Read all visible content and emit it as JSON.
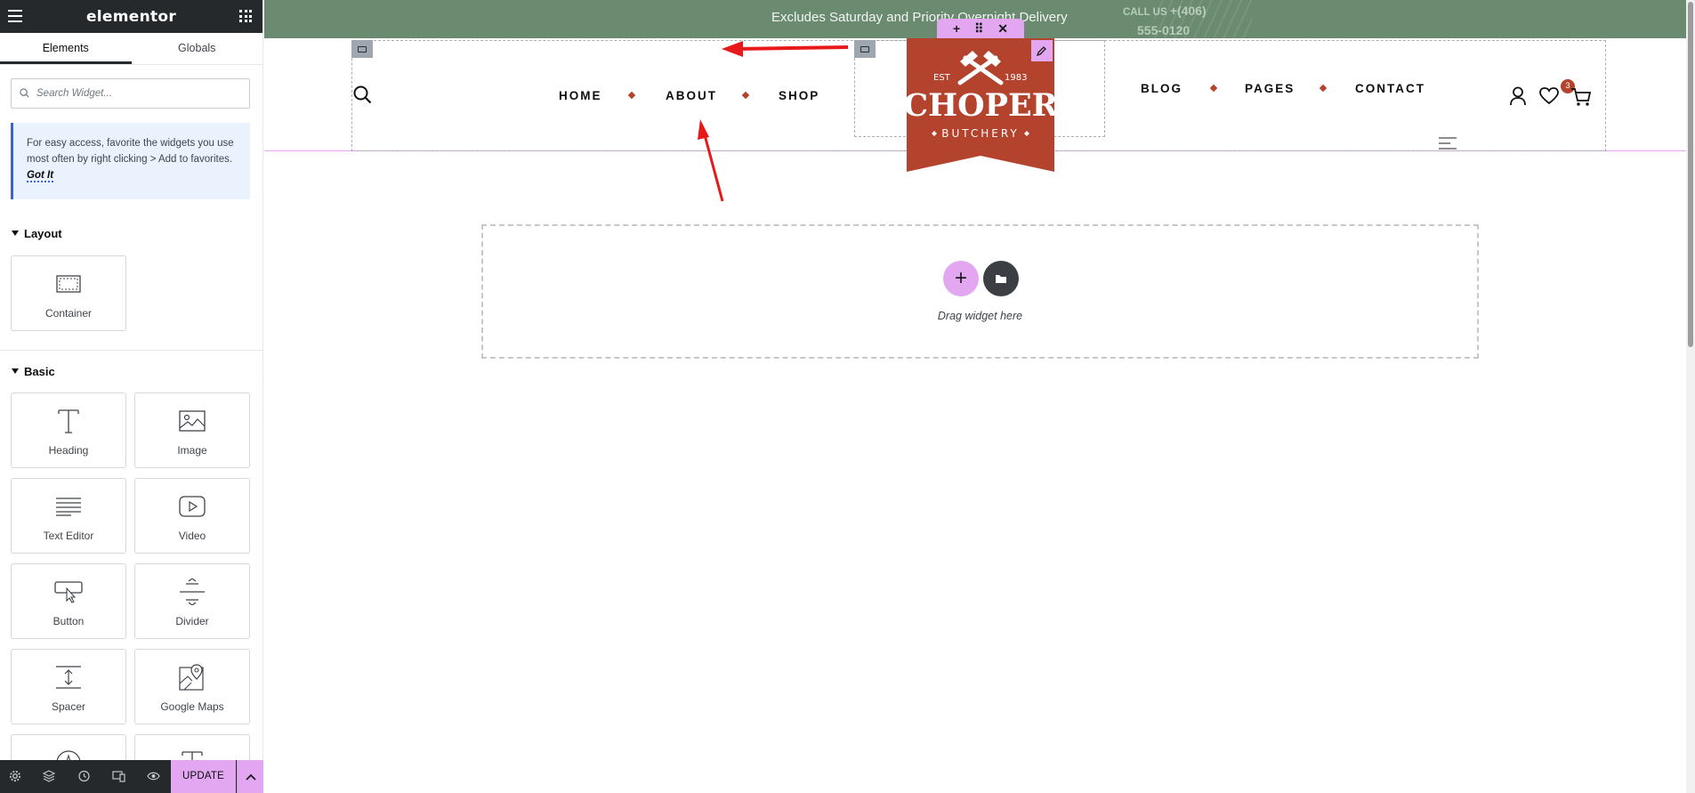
{
  "panel": {
    "brand": "elementor",
    "tabs": [
      {
        "label": "Elements",
        "active": true
      },
      {
        "label": "Globals",
        "active": false
      }
    ],
    "search_placeholder": "Search Widget...",
    "tip": {
      "text": "For easy access, favorite the widgets you use most often by right clicking > Add to favorites.",
      "link": "Got It"
    },
    "sections": {
      "layout": {
        "title": "Layout",
        "widgets": [
          {
            "label": "Container",
            "icon": "container-icon"
          }
        ]
      },
      "basic": {
        "title": "Basic",
        "widgets": [
          {
            "label": "Heading",
            "icon": "heading-icon"
          },
          {
            "label": "Image",
            "icon": "image-icon"
          },
          {
            "label": "Text Editor",
            "icon": "text-editor-icon"
          },
          {
            "label": "Video",
            "icon": "video-icon"
          },
          {
            "label": "Button",
            "icon": "button-icon"
          },
          {
            "label": "Divider",
            "icon": "divider-icon"
          },
          {
            "label": "Spacer",
            "icon": "spacer-icon"
          },
          {
            "label": "Google Maps",
            "icon": "google-maps-icon"
          }
        ]
      }
    },
    "footer": {
      "update_label": "UPDATE",
      "icons": [
        "settings-icon",
        "navigator-icon",
        "history-icon",
        "responsive-icon",
        "preview-icon",
        "chevron-up-icon"
      ]
    }
  },
  "canvas": {
    "topbar": {
      "message": "Excludes Saturday and Priority Overnight Delivery",
      "call_label": "CALL US",
      "call_number_1": "+(406)",
      "call_number_2": "555-0120"
    },
    "nav_left": [
      "HOME",
      "ABOUT",
      "SHOP"
    ],
    "nav_right": [
      "BLOG",
      "PAGES",
      "CONTACT"
    ],
    "logo": {
      "est": "EST",
      "year": "1983",
      "name": "CHOPER",
      "tagline": "BUTCHERY"
    },
    "logo_toolbar": [
      "+",
      "⠿",
      "✕"
    ],
    "wishlist_count": "3",
    "dropzone": {
      "label": "Drag widget here",
      "add_symbol": "+"
    },
    "colors": {
      "topbar": "#6b8b71",
      "brand_red": "#b4432e",
      "elementor_pink": "#e2a7f0",
      "annotation_arrow": "#e8191b"
    }
  }
}
